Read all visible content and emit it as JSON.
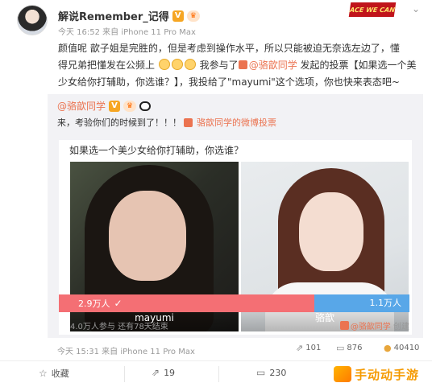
{
  "post": {
    "author": "解说Remember_记得",
    "vip_badge": "V",
    "fan_badge": "♛",
    "meta": "今天 16:52 来自 iPhone 11 Pro Max",
    "sticker_text": "ACE WE CAN",
    "text_line1": "颜值呢 歆子姐是完胜的，但是考虑到操作水平，所以只能被迫无奈选左边了，懂",
    "text_line2_a": "得兄弟把懂发在公频上",
    "text_line2_b": "我参与了",
    "vote_link": "@骆歆同学",
    "text_line2_c": "发起的投票【如果选一个美",
    "text_line3": "少女给你打辅助，你选谁？】，我投给了\"mayumi\"这个选项，你也快来表态吧~"
  },
  "repost": {
    "author": "@骆歆同学",
    "text": "来，考验你们的时候到了！！！",
    "vote_link": "骆歆同学的微博投票",
    "poll": {
      "question": "如果选一个美少女给你打辅助，你选谁？",
      "option_a": "mayumi",
      "option_b": "骆歆",
      "option_a_votes": "2.9万人",
      "option_b_votes": "1.1万人",
      "option_a_share": 0.728,
      "footer_left": "4.0万人参与 还有78天结束",
      "footer_right_link": "@骆歆同学",
      "footer_right_suffix": "创建"
    }
  },
  "repost_meta": {
    "time": "今天 15:31 来自 iPhone 11 Pro Max",
    "reposts": "101",
    "comments": "876",
    "likes": "40410"
  },
  "actions": {
    "favorite": "收藏",
    "forward": "19",
    "comment": "230"
  },
  "watermark": {
    "text": "手动动手游"
  }
}
